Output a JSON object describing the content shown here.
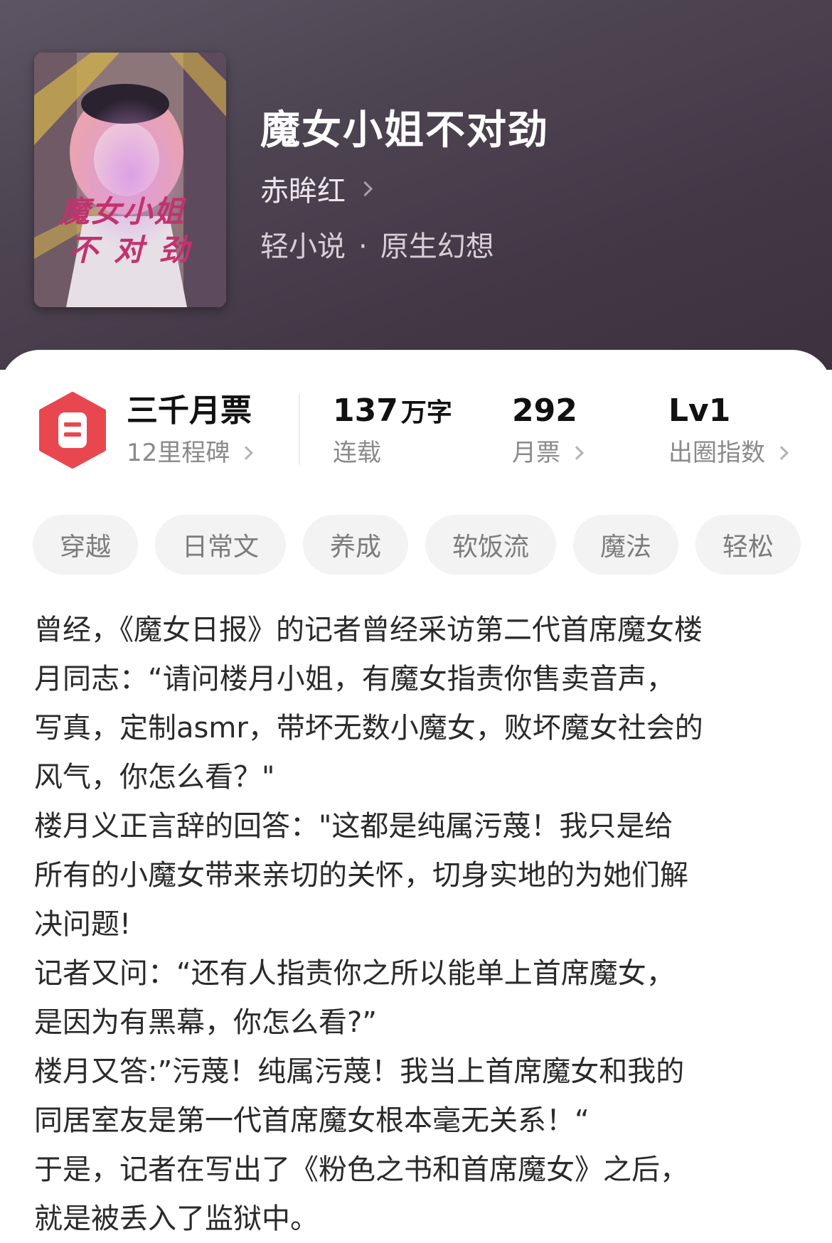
{
  "book": {
    "title": "魔女小姐不对劲",
    "author": "赤眸红",
    "category_main": "轻小说",
    "category_separator": "·",
    "category_sub": "原生幻想",
    "cover_text": [
      "魔女小姐",
      "不对劲"
    ]
  },
  "stats": {
    "badge": {
      "title": "三千月票",
      "subtitle": "12里程碑"
    },
    "word_count": {
      "value": "137",
      "unit": "万字",
      "label": "连载"
    },
    "monthly_tickets": {
      "value": "292",
      "label": "月票"
    },
    "level": {
      "value": "Lv1",
      "label": "出圈指数"
    }
  },
  "tags": [
    "穿越",
    "日常文",
    "养成",
    "软饭流",
    "魔法",
    "轻松"
  ],
  "description_lines": [
    "曾经，《魔女日报》的记者曾经采访第二代首席魔女楼",
    "月同志：“请问楼月小姐，有魔女指责你售卖音声，",
    "写真，定制asmr，带坏无数小魔女，败坏魔女社会的",
    "风气，你怎么看？\"",
    "楼月义正言辞的回答：\"这都是纯属污蔑！我只是给",
    "所有的小魔女带来亲切的关怀，切身实地的为她们解",
    "决问题!",
    "记者又问：“还有人指责你之所以能单上首席魔女，",
    "是因为有黑幕，你怎么看?”",
    "楼月又答:”污蔑！纯属污蔑！我当上首席魔女和我的",
    "同居室友是第一代首席魔女根本毫无关系！“",
    "于是，记者在写出了《粉色之书和首席魔女》之后，",
    "就是被丢入了监狱中。"
  ],
  "colors": {
    "header_bg": "#4d4452",
    "badge_red": "#e8474f",
    "tag_bg": "#f3f3f3",
    "text_main": "#2a2a2a",
    "text_muted": "#8a8a8a"
  },
  "icons": {
    "badge": "ticket-hexagon-icon",
    "chevron": "chevron-right-icon"
  }
}
